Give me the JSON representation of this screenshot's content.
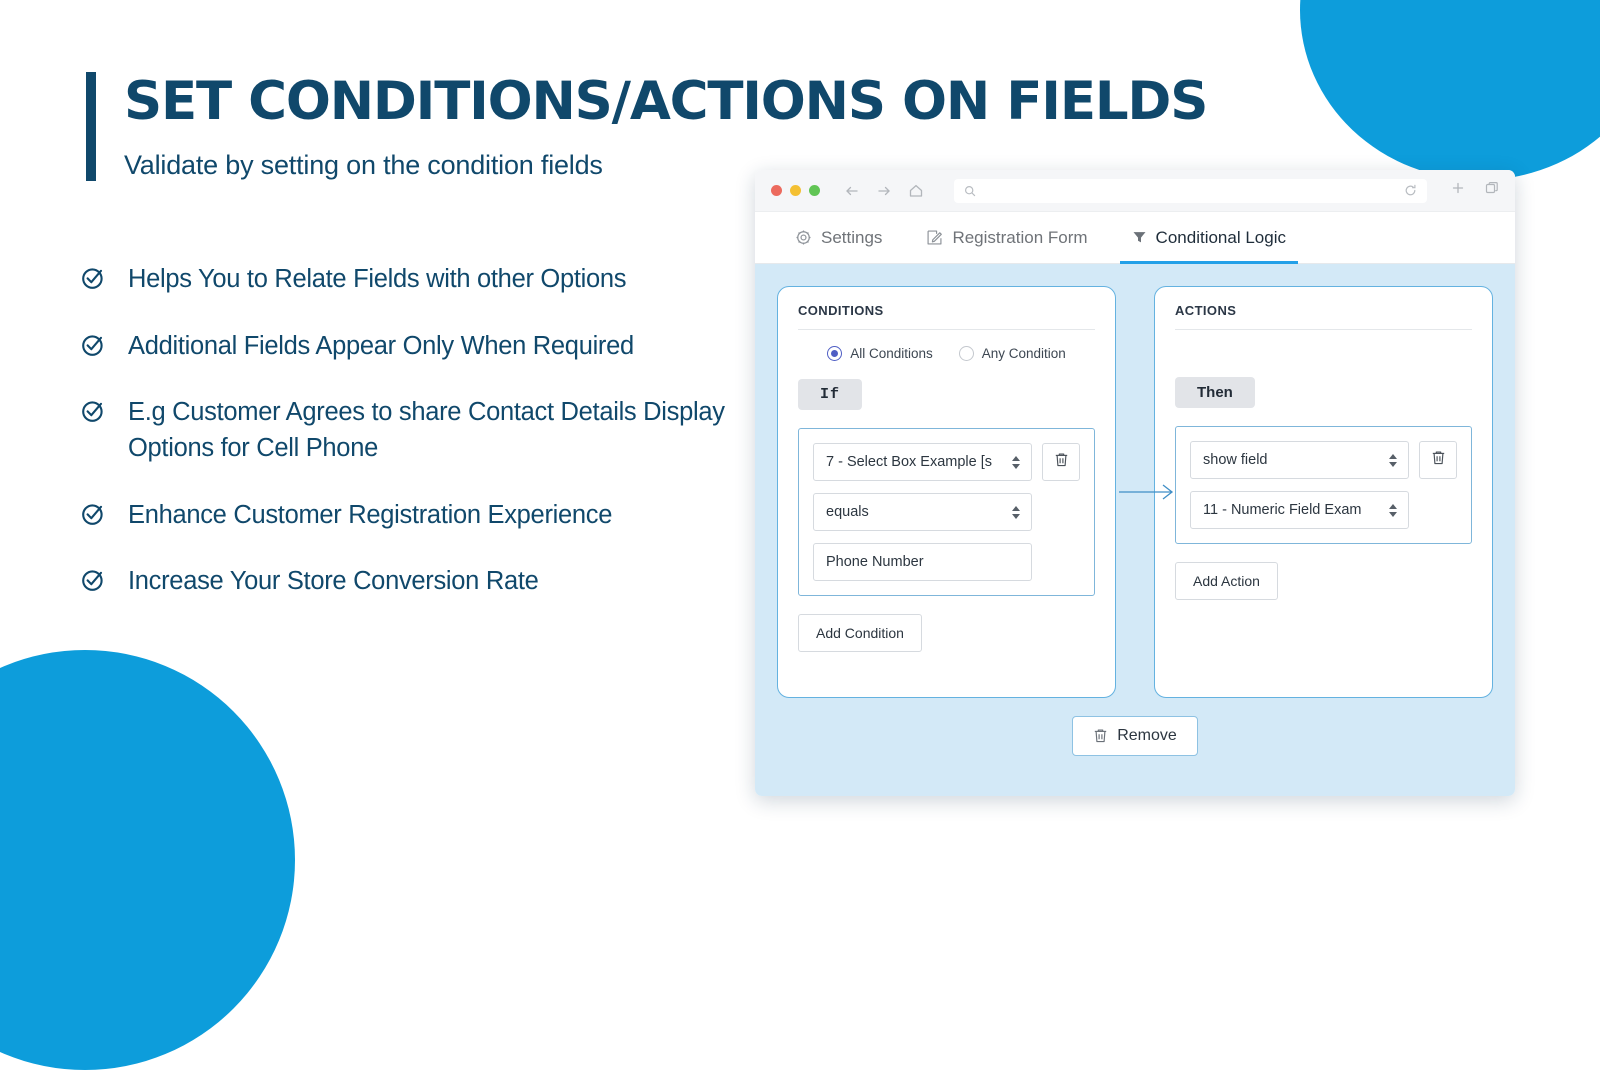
{
  "slide": {
    "title": "SET CONDITIONS/ACTIONS ON FIELDS",
    "subtitle": "Validate by setting on the condition fields",
    "accent_dark": "#10486b",
    "accent_blue": "#0d9ddb",
    "bullets": [
      {
        "icon": "check-circle-icon",
        "text": "Helps You to Relate Fields with other Options"
      },
      {
        "icon": "check-circle-icon",
        "text": "Additional Fields Appear Only When Required"
      },
      {
        "icon": "check-circle-icon",
        "text": "E.g Customer Agrees to share Contact Details Display Options for Cell Phone"
      },
      {
        "icon": "check-circle-icon",
        "text": "Enhance Customer Registration Experience"
      },
      {
        "icon": "check-circle-icon",
        "text": "Increase Your Store Conversion Rate"
      }
    ]
  },
  "browser": {
    "traffic_lights": [
      "red",
      "yellow",
      "green"
    ],
    "nav": {
      "back": "back-arrow-icon",
      "forward": "forward-arrow-icon",
      "home": "home-icon"
    },
    "address_bar": {
      "value": "",
      "placeholder": ""
    },
    "reload_icon": "reload-icon",
    "new_tab_icon": "plus-icon",
    "windows_icon": "copy-windows-icon"
  },
  "tabs": [
    {
      "label": "Settings",
      "icon": "gear-icon",
      "active": false
    },
    {
      "label": "Registration Form",
      "icon": "edit-square-icon",
      "active": false
    },
    {
      "label": "Conditional Logic",
      "icon": "filter-funnel-icon",
      "active": true
    }
  ],
  "conditions_panel": {
    "title": "CONDITIONS",
    "match_mode": {
      "selected": "All Conditions",
      "options": [
        "All Conditions",
        "Any Condition"
      ]
    },
    "badge": "If",
    "rows": [
      {
        "field_select": {
          "value": "7 - Select Box Example [s",
          "icon": "spinner-arrows-icon"
        },
        "operator_select": {
          "value": "equals",
          "icon": "spinner-arrows-icon"
        },
        "value_input": {
          "value": "Phone Number",
          "placeholder": ""
        },
        "delete_icon": "trash-icon"
      }
    ],
    "add_button": "Add Condition"
  },
  "actions_panel": {
    "title": "ACTIONS",
    "badge": "Then",
    "rows": [
      {
        "action_select": {
          "value": "show field",
          "icon": "spinner-arrows-icon"
        },
        "target_select": {
          "value": "11 - Numeric Field Exam",
          "icon": "spinner-arrows-icon"
        },
        "delete_icon": "trash-icon"
      }
    ],
    "add_button": "Add Action"
  },
  "footer": {
    "remove_button": "Remove",
    "remove_icon": "trash-icon"
  },
  "colors": {
    "panel_background": "#d3e9f7",
    "panel_border": "#64b2e0",
    "tab_active_underline": "#23a0e8",
    "radio_selected": "#4f5ec4",
    "badge_background": "#e2e4e8"
  }
}
